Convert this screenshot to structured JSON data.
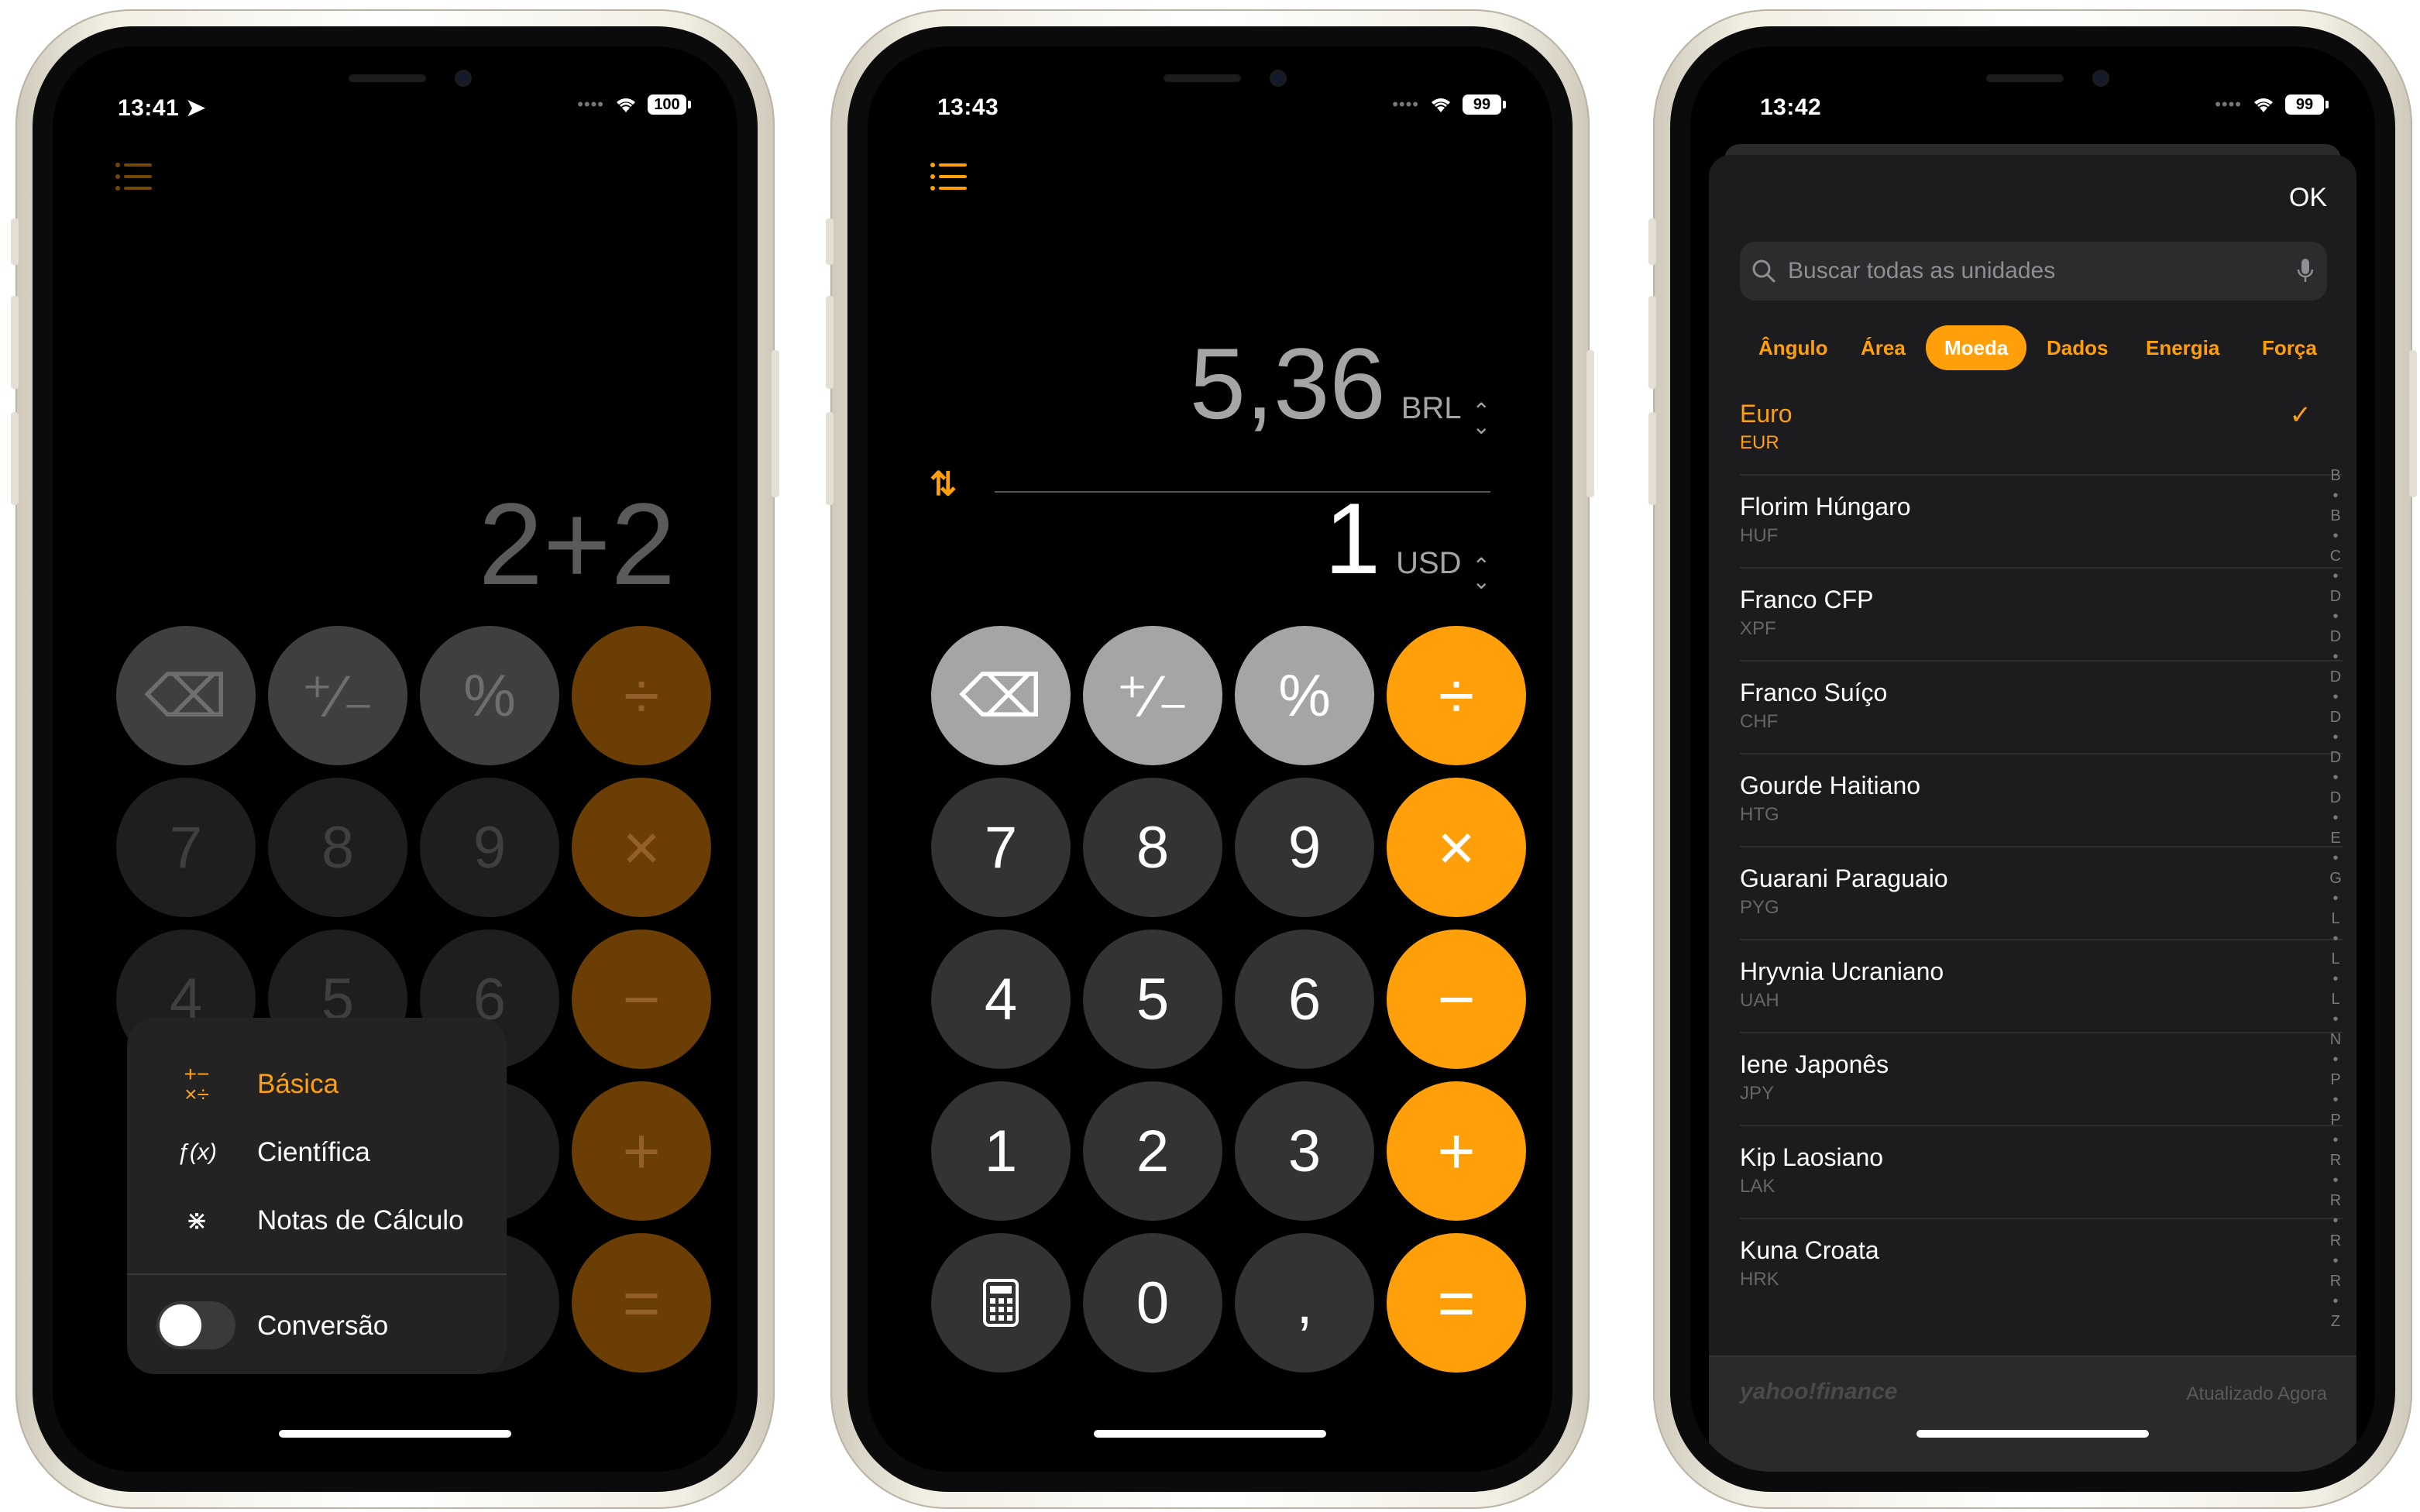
{
  "phone1": {
    "time": "13:41",
    "battery": "100",
    "display": "2+2",
    "keys": {
      "row1": [
        "⌫",
        "⁺∕₋",
        "%",
        "÷"
      ],
      "row2": [
        "7",
        "8",
        "9",
        "×"
      ],
      "row3": [
        "4",
        "5",
        "6",
        "−"
      ],
      "row4": [
        "+"
      ],
      "row5": [
        "="
      ]
    },
    "menu": {
      "basic": "Básica",
      "scientific": "Científica",
      "notes": "Notas de Cálculo",
      "conversion": "Conversão"
    }
  },
  "phone2": {
    "time": "13:43",
    "battery": "99",
    "top_value": "5,36",
    "top_currency": "BRL",
    "bottom_value": "1",
    "bottom_currency": "USD",
    "keys": {
      "r1": [
        "⌫",
        "⁺∕₋",
        "%",
        "÷"
      ],
      "r2": [
        "7",
        "8",
        "9",
        "×"
      ],
      "r3": [
        "4",
        "5",
        "6",
        "−"
      ],
      "r4": [
        "1",
        "2",
        "3",
        "+"
      ],
      "r5": [
        "0",
        ",",
        "="
      ]
    }
  },
  "phone3": {
    "time": "13:42",
    "battery": "99",
    "ok": "OK",
    "search_placeholder": "Buscar todas as unidades",
    "categories": [
      "Ângulo",
      "Área",
      "Moeda",
      "Dados",
      "Energia",
      "Força"
    ],
    "selected_category": "Moeda",
    "currencies": [
      {
        "name": "Euro",
        "code": "EUR"
      },
      {
        "name": "Florim Húngaro",
        "code": "HUF"
      },
      {
        "name": "Franco CFP",
        "code": "XPF"
      },
      {
        "name": "Franco Suíço",
        "code": "CHF"
      },
      {
        "name": "Gourde Haitiano",
        "code": "HTG"
      },
      {
        "name": "Guarani Paraguaio",
        "code": "PYG"
      },
      {
        "name": "Hryvnia Ucraniano",
        "code": "UAH"
      },
      {
        "name": "Iene Japonês",
        "code": "JPY"
      },
      {
        "name": "Kip Laosiano",
        "code": "LAK"
      },
      {
        "name": "Kuna Croata",
        "code": "HRK"
      }
    ],
    "index_letters": [
      "B",
      "•",
      "B",
      "•",
      "C",
      "•",
      "D",
      "•",
      "D",
      "•",
      "D",
      "•",
      "D",
      "•",
      "D",
      "•",
      "D",
      "•",
      "E",
      "•",
      "G",
      "•",
      "L",
      "•",
      "L",
      "•",
      "L",
      "•",
      "N",
      "•",
      "P",
      "•",
      "P",
      "•",
      "R",
      "•",
      "R",
      "•",
      "R",
      "•",
      "R",
      "•",
      "Z"
    ],
    "footer_source": "yahoo!finance",
    "footer_updated": "Atualizado Agora"
  },
  "colors": {
    "accent": "#ff9f0a",
    "dark_key": "#333333",
    "gray_key": "#a5a5a5"
  }
}
